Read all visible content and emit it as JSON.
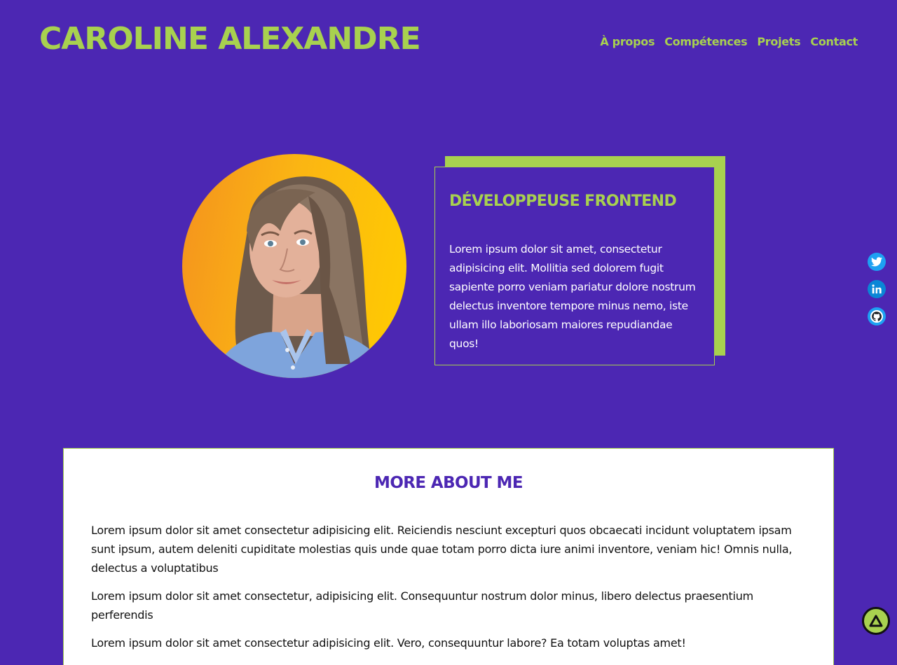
{
  "header": {
    "title": "CAROLINE ALEXANDRE",
    "nav": [
      "À propos",
      "Compétences",
      "Projets",
      "Contact"
    ]
  },
  "hero": {
    "heading": "DÉVELOPPEUSE FRONTEND",
    "text": "Lorem ipsum dolor sit amet, consectetur adipisicing elit. Mollitia sed dolorem fugit sapiente porro veniam pariatur dolore nostrum delectus inventore tempore minus nemo, iste ullam illo laboriosam maiores repudiandae quos!"
  },
  "socials": [
    {
      "icon": "twitter-icon"
    },
    {
      "icon": "linkedin-icon"
    },
    {
      "icon": "github-icon"
    }
  ],
  "about": {
    "title": "MORE ABOUT ME",
    "paragraphs": [
      "Lorem ipsum dolor sit amet consectetur adipisicing elit. Reiciendis nesciunt excepturi quos obcaecati incidunt voluptatem ipsam sunt ipsum, autem deleniti cupiditate molestias quis unde quae totam porro dicta iure animi inventore, veniam hic! Omnis nulla, delectus a voluptatibus",
      "Lorem ipsum dolor sit amet consectetur, adipisicing elit. Consequuntur nostrum dolor minus, libero delectus praesentium perferendis",
      "Lorem ipsum dolor sit amet consectetur adipisicing elit. Vero, consequuntur labore? Ea totam voluptas amet!"
    ]
  },
  "back_to_top": {
    "icon": "arrow-up-triangle-icon"
  },
  "colors": {
    "background": "#4c27b3",
    "accent": "#a8d14f",
    "card_background": "#ffffff",
    "text_dark": "#111111"
  }
}
